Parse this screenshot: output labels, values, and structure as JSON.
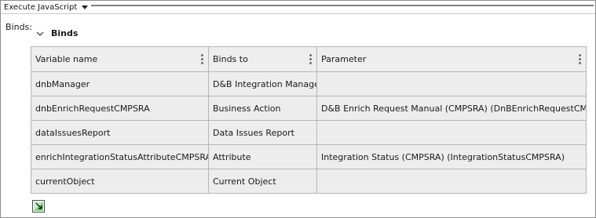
{
  "header": {
    "title": "Execute JavaScript"
  },
  "binds_label": "Binds:",
  "section": {
    "title": "Binds"
  },
  "table": {
    "columns": [
      "Variable name",
      "Binds to",
      "Parameter"
    ],
    "rows": [
      [
        "dnbManager",
        "D&B Integration Manager",
        ""
      ],
      [
        "dnbEnrichRequestCMPSRA",
        "Business Action",
        "D&B Enrich Request Manual (CMPSRA) (DnBEnrichRequestCMPSRA)"
      ],
      [
        "dataIssuesReport",
        "Data Issues Report",
        ""
      ],
      [
        "enrichIntegrationStatusAttributeCMPSRA",
        "Attribute",
        "Integration Status (CMPSRA) (IntegrationStatusCMPSRA)"
      ],
      [
        "currentObject",
        "Current Object",
        ""
      ]
    ]
  },
  "icons": {
    "header_dropdown": "triangle-down-icon",
    "section_toggle": "chevron-down-icon",
    "column_menu": "vertical-dots-icon",
    "add_row": "add-bind-icon"
  }
}
